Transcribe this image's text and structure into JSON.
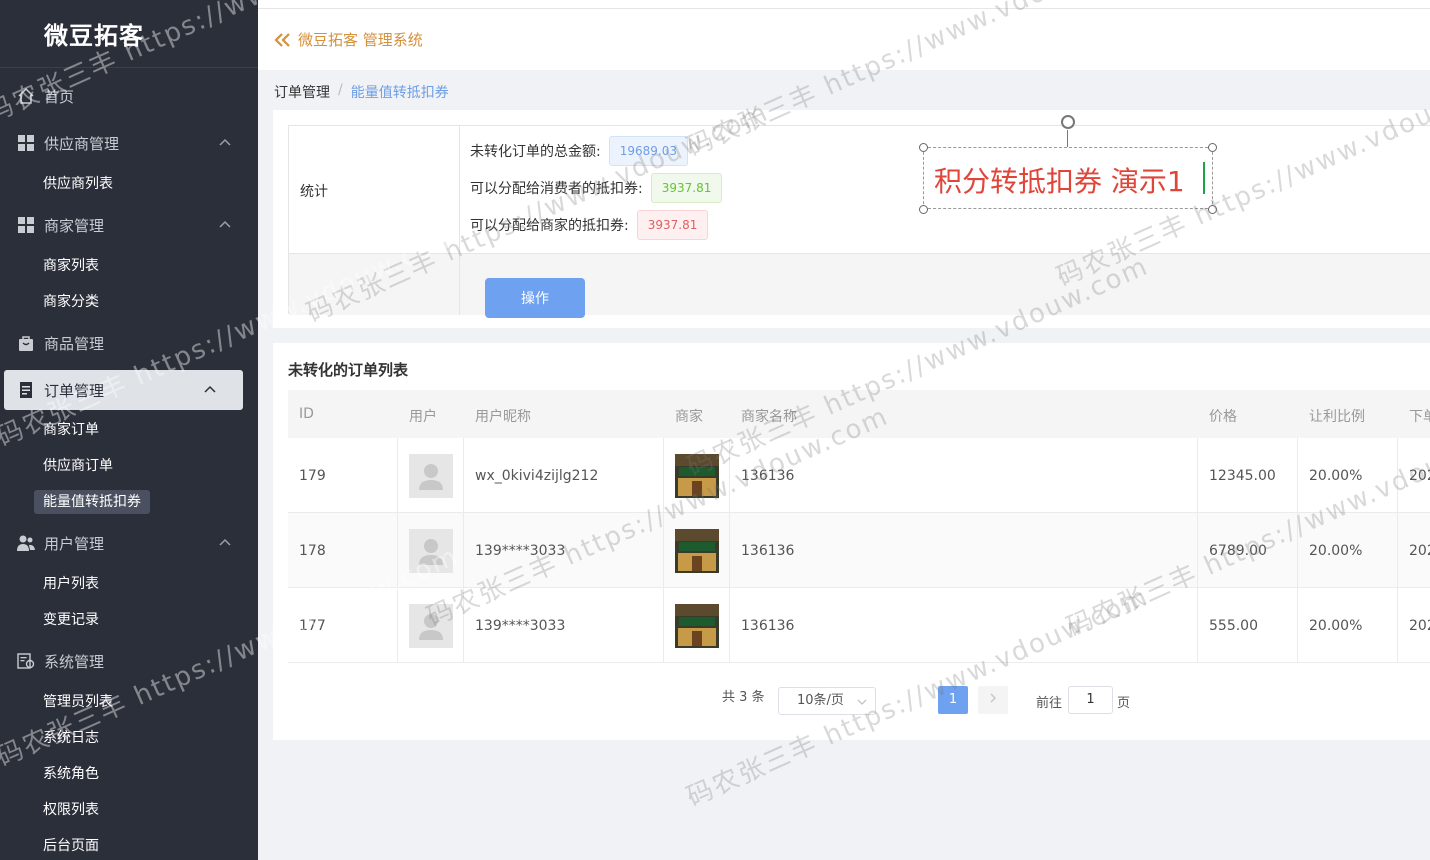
{
  "app": {
    "name": "微豆拓客",
    "title": "微豆拓客 管理系统"
  },
  "sidebar": {
    "home": "首页",
    "groups": [
      {
        "label": "供应商管理",
        "icon": "grid-icon",
        "items": [
          "供应商列表"
        ]
      },
      {
        "label": "商家管理",
        "icon": "grid-icon",
        "items": [
          "商家列表",
          "商家分类"
        ]
      },
      {
        "label": "商品管理",
        "icon": "bag-icon",
        "items": []
      },
      {
        "label": "订单管理",
        "icon": "order-icon",
        "items": [
          "商家订单",
          "供应商订单",
          "能量值转抵扣券"
        ]
      },
      {
        "label": "用户管理",
        "icon": "users-icon",
        "items": [
          "用户列表",
          "变更记录"
        ]
      },
      {
        "label": "系统管理",
        "icon": "settings-icon",
        "items": [
          "管理员列表",
          "系统日志",
          "系统角色",
          "权限列表",
          "后台页面"
        ]
      }
    ]
  },
  "breadcrumb": {
    "parent": "订单管理",
    "current": "能量值转抵扣券"
  },
  "stats": {
    "label": "统计",
    "total_label": "未转化订单的总金额:",
    "total_value": "19689.03",
    "consumer_label": "可以分配给消费者的抵扣券:",
    "consumer_value": "3937.81",
    "merchant_label": "可以分配给商家的抵扣券:",
    "merchant_value": "3937.81",
    "action_button": "操作"
  },
  "annotation": {
    "text": "积分转抵扣券 演示1"
  },
  "orders": {
    "title": "未转化的订单列表",
    "columns": [
      "ID",
      "用户",
      "用户昵称",
      "商家",
      "商家名称",
      "价格",
      "让利比例",
      "下单"
    ],
    "rows": [
      {
        "id": "179",
        "nickname": "wx_0kivi4zijlg212",
        "merchant_name": "136136",
        "price": "12345.00",
        "ratio": "20.00%",
        "date": "202"
      },
      {
        "id": "178",
        "nickname": "139****3033",
        "merchant_name": "136136",
        "price": "6789.00",
        "ratio": "20.00%",
        "date": "202"
      },
      {
        "id": "177",
        "nickname": "139****3033",
        "merchant_name": "136136",
        "price": "555.00",
        "ratio": "20.00%",
        "date": "202"
      }
    ]
  },
  "pagination": {
    "total": "共 3 条",
    "page_size": "10条/页",
    "current": "1",
    "goto": "前往",
    "goto_value": "1",
    "page_suffix": "页"
  },
  "watermark": {
    "text": "码农张三丰 https://www.vdouw.com"
  },
  "colors": {
    "sidebar_bg": "#2b2f3a",
    "accent": "#6ea1f0",
    "title_orange": "#d4903a",
    "annotation_red": "#e0453a"
  }
}
